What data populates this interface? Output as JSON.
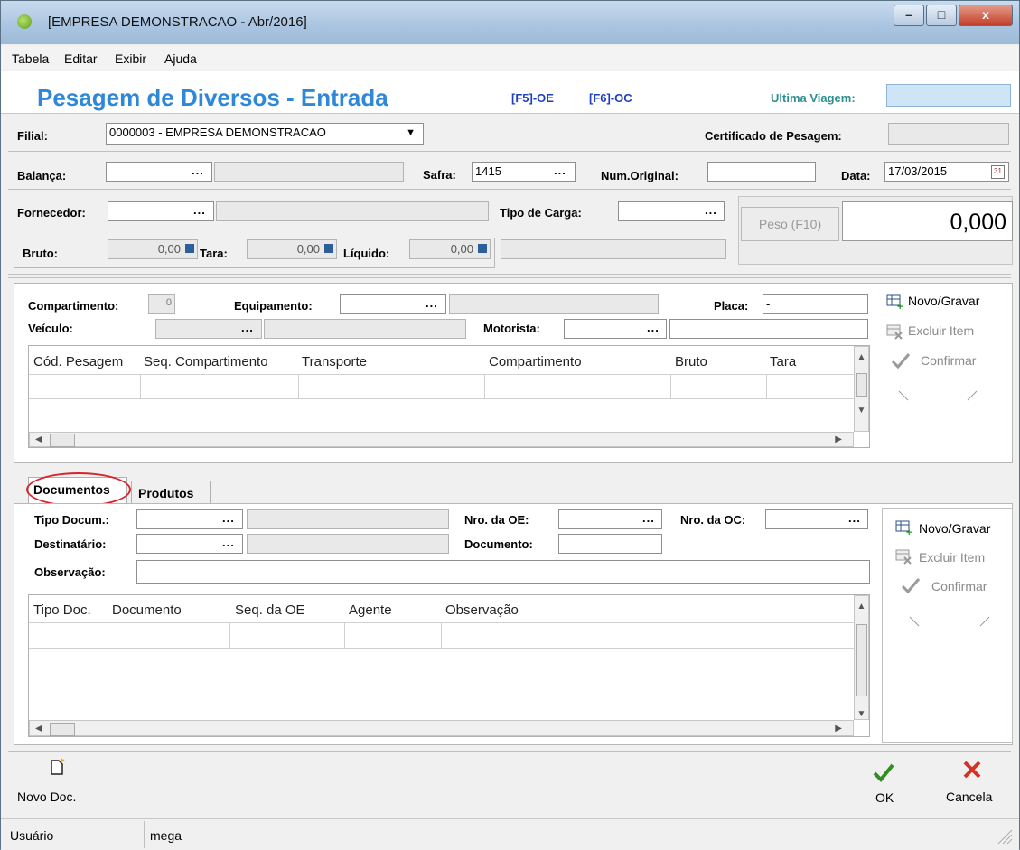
{
  "window": {
    "title": "[EMPRESA DEMONSTRACAO - Abr/2016]",
    "minimize": "–",
    "maximize": "□",
    "close": "x"
  },
  "menu": [
    {
      "label": "Tabela"
    },
    {
      "label": "Editar"
    },
    {
      "label": "Exibir"
    },
    {
      "label": "Ajuda"
    }
  ],
  "header": {
    "title": "Pesagem de Diversos - Entrada",
    "f5": "[F5]-OE",
    "f6": "[F6]-OC",
    "ultima_viagem_label": "Ultima Viagem:",
    "ultima_viagem_value": ""
  },
  "form": {
    "filial_label": "Filial:",
    "filial_value": "0000003 - EMPRESA DEMONSTRACAO",
    "certificado_label": "Certificado de Pesagem:",
    "balanca_label": "Balança:",
    "safra_label": "Safra:",
    "safra_value": "1415",
    "num_original_label": "Num.Original:",
    "data_label": "Data:",
    "data_value": "17/03/2015",
    "fornecedor_label": "Fornecedor:",
    "tipo_carga_label": "Tipo de Carga:",
    "peso_button": "Peso (F10)",
    "peso_value": "0,000",
    "bruto_label": "Bruto:",
    "bruto_value": "0,00",
    "tara_label": "Tara:",
    "tara_value": "0,00",
    "liquido_label": "Líquido:",
    "liquido_value": "0,00",
    "ellipsis": "..."
  },
  "compartimento": {
    "compartimento_label": "Compartimento:",
    "compartimento_value": "0",
    "equipamento_label": "Equipamento:",
    "placa_label": "Placa:",
    "placa_value": "-",
    "veiculo_label": "Veículo:",
    "motorista_label": "Motorista:",
    "columns": [
      "Cód. Pesagem",
      "Seq. Compartimento",
      "Transporte",
      "Compartimento",
      "Bruto",
      "Tara"
    ],
    "actions": {
      "novo": "Novo/Gravar",
      "excluir": "Excluir Item",
      "confirmar": "Confirmar"
    }
  },
  "tabs": [
    {
      "label": "Documentos"
    },
    {
      "label": "Produtos"
    }
  ],
  "documentos": {
    "tipo_docum_label": "Tipo Docum.:",
    "nro_oe_label": "Nro. da OE:",
    "nro_oc_label": "Nro. da OC:",
    "destinatario_label": "Destinatário:",
    "documento_label": "Documento:",
    "observacao_label": "Observação:",
    "columns": [
      "Tipo Doc.",
      "Documento",
      "Seq. da OE",
      "Agente",
      "Observação"
    ],
    "actions": {
      "novo": "Novo/Gravar",
      "excluir": "Excluir Item",
      "confirmar": "Confirmar"
    }
  },
  "footer": {
    "novo_doc": "Novo Doc.",
    "ok": "OK",
    "cancela": "Cancela"
  },
  "status": {
    "user_label": "Usuário",
    "user_value": "mega"
  },
  "colors": {
    "title": "#2e87d7",
    "fkey": "#1e3fbf",
    "teal": "#2e8f8f",
    "ok": "#2f8f1f",
    "cancel": "#d63222",
    "highlight": "#d6262a"
  }
}
